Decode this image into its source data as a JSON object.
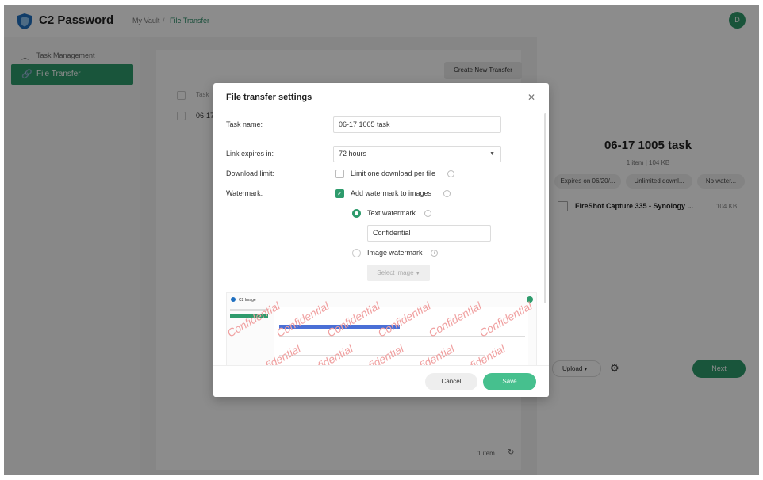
{
  "app": {
    "title": "C2 Password",
    "breadcrumb": {
      "vault": "My Vault",
      "separator": "/",
      "current": "File Transfer"
    },
    "avatar_letter": "D",
    "accent": "#2e9b6c"
  },
  "sidebar": {
    "group_label": "Task Management",
    "items": [
      {
        "label": "File Transfer",
        "icon": "link-icon",
        "active": true
      }
    ]
  },
  "main": {
    "create_button": "Create New Transfer",
    "table": {
      "header": "Task",
      "rows": [
        {
          "name": "06-17"
        }
      ]
    },
    "footer": {
      "count": "1 item"
    }
  },
  "detail": {
    "title": "06-17 1005 task",
    "subtitle": "1 item | 104 KB",
    "tags": [
      "Expires on 06/20/...",
      "Unlimited downl...",
      "No water..."
    ],
    "file": {
      "name": "FireShot Capture 335 - Synology ...",
      "size": "104 KB"
    },
    "upload_label": "Upload",
    "next_label": "Next"
  },
  "modal": {
    "title": "File transfer settings",
    "task_name_label": "Task name:",
    "task_name_value": "06-17 1005 task",
    "expires_label": "Link expires in:",
    "expires_value": "72 hours",
    "download_limit_label": "Download limit:",
    "download_limit_option": "Limit one download per file",
    "download_limit_checked": false,
    "watermark_label": "Watermark:",
    "watermark_option": "Add watermark to images",
    "watermark_checked": true,
    "text_watermark_label": "Text watermark",
    "text_watermark_selected": true,
    "text_watermark_value": "Confidential",
    "image_watermark_label": "Image watermark",
    "select_image_label": "Select image",
    "preview": {
      "app_name": "C2 Image",
      "watermark_text": "Confidential"
    },
    "cancel_label": "Cancel",
    "save_label": "Save"
  }
}
